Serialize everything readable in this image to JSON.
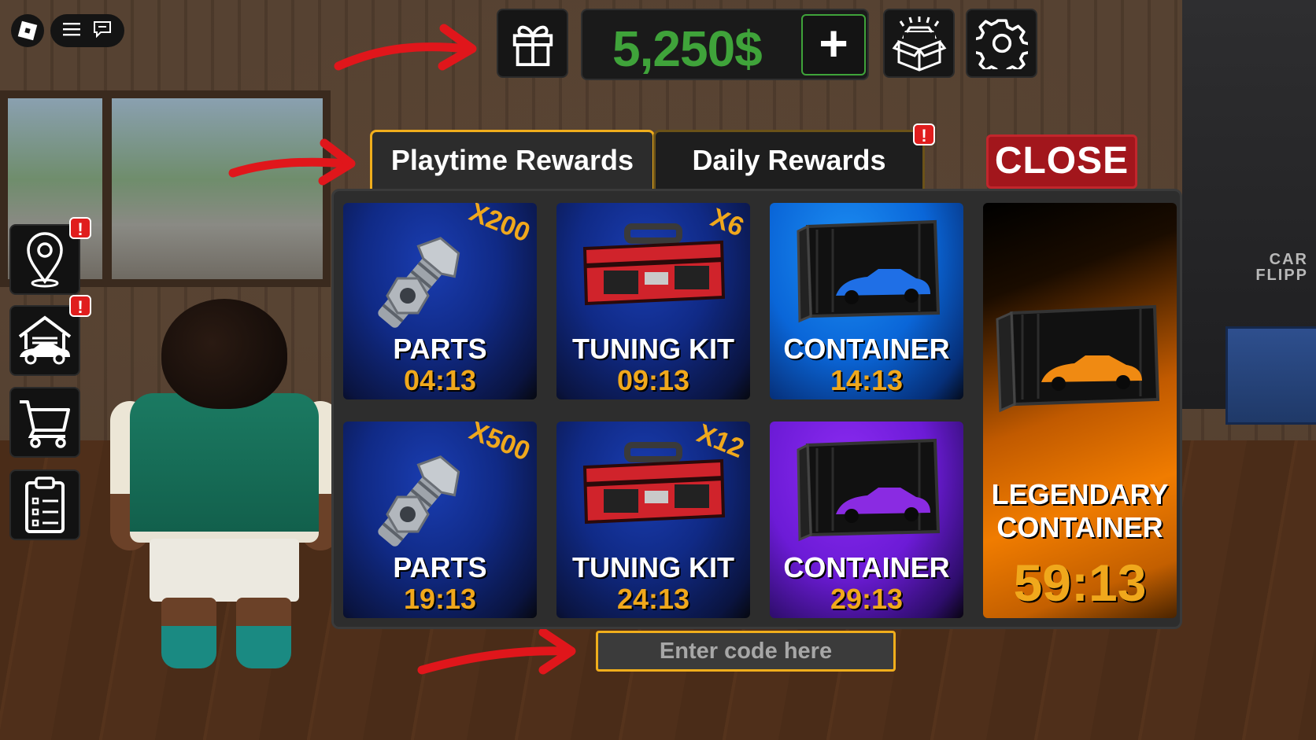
{
  "hud": {
    "money": "5,250$",
    "plus_label": "+",
    "icons": [
      "gift-icon",
      "car-box-icon",
      "gear-icon"
    ]
  },
  "topbar": {
    "icons": [
      "roblox-logo-icon",
      "menu-icon",
      "chat-icon"
    ]
  },
  "sidebar": {
    "items": [
      {
        "icon": "map-pin-icon",
        "badge": "!"
      },
      {
        "icon": "garage-icon",
        "badge": "!"
      },
      {
        "icon": "cart-icon"
      },
      {
        "icon": "clipboard-icon"
      }
    ]
  },
  "tabs": {
    "playtime": "Playtime Rewards",
    "daily": "Daily Rewards",
    "daily_badge": "!"
  },
  "close_label": "CLOSE",
  "rewards": [
    {
      "title": "PARTS",
      "time": "04:13",
      "multiplier": "X200",
      "theme": "blue",
      "icon": "bolt-nut-icon"
    },
    {
      "title": "TUNING KIT",
      "time": "09:13",
      "multiplier": "X6",
      "theme": "blue",
      "icon": "toolbox-icon"
    },
    {
      "title": "CONTAINER",
      "time": "14:13",
      "multiplier": "",
      "theme": "sky",
      "icon": "container-car-icon"
    },
    {
      "title": "PARTS",
      "time": "19:13",
      "multiplier": "X500",
      "theme": "blue",
      "icon": "bolt-nut-icon"
    },
    {
      "title": "TUNING KIT",
      "time": "24:13",
      "multiplier": "X12",
      "theme": "blue",
      "icon": "toolbox-icon"
    },
    {
      "title": "CONTAINER",
      "time": "29:13",
      "multiplier": "",
      "theme": "violet",
      "icon": "container-car-icon"
    }
  ],
  "legendary": {
    "title_line1": "LEGENDARY",
    "title_line2": "CONTAINER",
    "time": "59:13",
    "icon": "container-car-icon"
  },
  "code_input": {
    "placeholder": "Enter code here",
    "value": ""
  },
  "background": {
    "sign_text": "CAR\nFLIPP"
  },
  "colors": {
    "accent": "#f0ae1c",
    "money_green": "#3fa33a",
    "close_red": "#a2161c",
    "arrow_red": "#e0161b"
  }
}
